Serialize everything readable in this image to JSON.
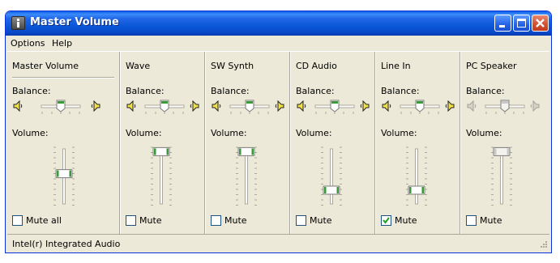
{
  "window": {
    "title": "Master Volume"
  },
  "menu": {
    "items": [
      "Options",
      "Help"
    ]
  },
  "labels": {
    "balance": "Balance:",
    "volume": "Volume:"
  },
  "channels": [
    {
      "name": "Master Volume",
      "balance_pct": 50,
      "volume_pct": 55,
      "mute_label": "Mute all",
      "muted": false,
      "enabled": true
    },
    {
      "name": "Wave",
      "balance_pct": 50,
      "volume_pct": 95,
      "mute_label": "Mute",
      "muted": false,
      "enabled": true
    },
    {
      "name": "SW Synth",
      "balance_pct": 50,
      "volume_pct": 95,
      "mute_label": "Mute",
      "muted": false,
      "enabled": true
    },
    {
      "name": "CD Audio",
      "balance_pct": 50,
      "volume_pct": 25,
      "mute_label": "Mute",
      "muted": false,
      "enabled": true
    },
    {
      "name": "Line In",
      "balance_pct": 50,
      "volume_pct": 25,
      "mute_label": "Mute",
      "muted": true,
      "enabled": true
    },
    {
      "name": "PC Speaker",
      "balance_pct": 50,
      "volume_pct": 95,
      "mute_label": "Mute",
      "muted": false,
      "enabled": false
    }
  ],
  "status": {
    "device": "Intel(r) Integrated Audio"
  },
  "colors": {
    "accent_green": "#3a9a3a",
    "title_blue": "#0a58d8",
    "checkmark": "#21a121"
  },
  "icons": {
    "app": "info-icon",
    "left_speaker": "speaker-left-icon",
    "right_speaker": "speaker-right-icon",
    "minimize": "minimize-icon",
    "maximize": "maximize-icon",
    "close": "close-icon"
  }
}
